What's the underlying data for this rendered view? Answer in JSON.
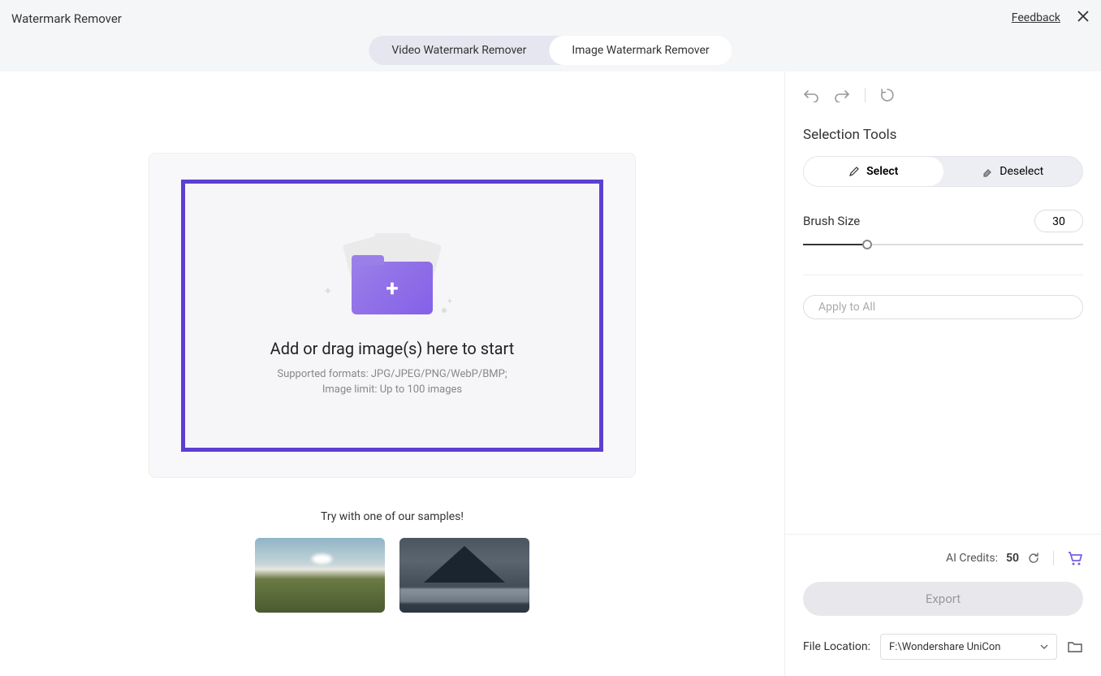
{
  "header": {
    "title": "Watermark Remover",
    "feedback": "Feedback",
    "tabs": {
      "video": "Video Watermark Remover",
      "image": "Image Watermark Remover"
    }
  },
  "dropzone": {
    "title": "Add or drag image(s) here to start",
    "formats": "Supported formats: JPG/JPEG/PNG/WebP/BMP;",
    "limit": "Image limit: Up to 100 images"
  },
  "samples": {
    "label": "Try with one of our samples!"
  },
  "sidebar": {
    "selection_tools": "Selection Tools",
    "select": "Select",
    "deselect": "Deselect",
    "brush_size_label": "Brush Size",
    "brush_size_value": "30",
    "apply_all": "Apply to All"
  },
  "footer": {
    "credits_label": "AI Credits:",
    "credits_value": "50",
    "export": "Export",
    "file_location_label": "File Location:",
    "file_location_value": "F:\\Wondershare UniCon"
  }
}
